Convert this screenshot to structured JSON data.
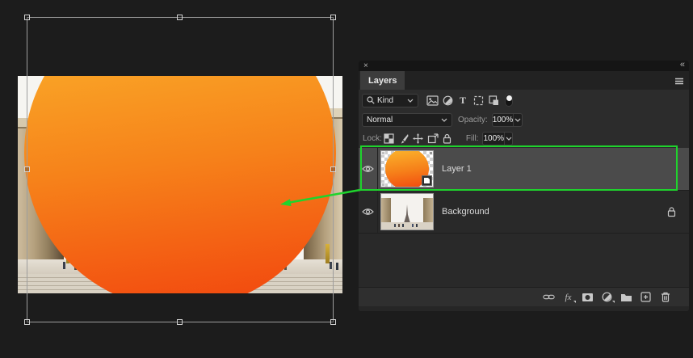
{
  "colors": {
    "accent_green": "#1fd32d",
    "circle_top": "#fbb12b",
    "circle_mid": "#f6821a",
    "circle_bottom": "#f2490f",
    "selected_row": "#4b4b4b"
  },
  "canvas": {
    "content": "orange gradient circle over colonnade photo",
    "selection": "transform-bounding-box"
  },
  "panel": {
    "close_glyph": "×",
    "collapse_glyph": "«",
    "tab_label": "Layers",
    "menu_icon": "hamburger-icon",
    "filter_row": {
      "search_icon": "search-icon",
      "kind_label": "Kind",
      "filter_icons": [
        "pixel-layers-icon",
        "adjustment-layers-icon",
        "type-layers-icon",
        "shape-layers-icon",
        "smart-object-icon"
      ],
      "type_glyph": "T",
      "toggle_icon": "layer-filter-toggle"
    },
    "blend_row": {
      "mode_value": "Normal",
      "opacity_label": "Opacity:",
      "opacity_value": "100%"
    },
    "lock_row": {
      "lock_label": "Lock:",
      "lock_icons": [
        "lock-transparency-icon",
        "lock-pixels-icon",
        "lock-position-icon",
        "lock-artboard-icon",
        "lock-all-icon"
      ],
      "fill_label": "Fill:",
      "fill_value": "100%"
    },
    "layers": [
      {
        "name": "Layer 1",
        "selected": true,
        "visible": true,
        "thumbnail": "orange-gradient-circle",
        "badge": "smart-object"
      },
      {
        "name": "Background",
        "selected": false,
        "visible": true,
        "locked": true,
        "thumbnail": "eiffel-tower-colonnade-photo"
      }
    ],
    "footer_icons": {
      "link": "link-layers-icon",
      "fx_label": "fx",
      "mask": "add-layer-mask-icon",
      "adjustment": "adjustment-layer-icon",
      "group": "new-group-icon",
      "new_layer": "new-layer-icon",
      "delete": "delete-layer-icon"
    }
  }
}
